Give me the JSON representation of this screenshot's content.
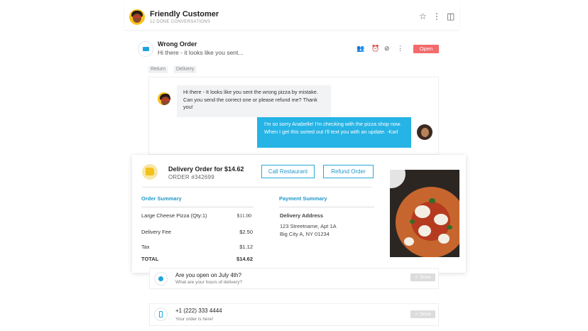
{
  "header": {
    "name": "Friendly Customer",
    "subtitle": "12 DONE CONVERSATIONS",
    "star_icon": "☆",
    "more_icon": "⋮",
    "panel_icon": "◫"
  },
  "conversation": {
    "title": "Wrong Order",
    "preview": "Hi there - it looks like you sent...",
    "assign_icon": "👥",
    "snooze_icon": "⏰",
    "done_icon": "⊘",
    "more_icon": "⋮",
    "status": "Open"
  },
  "tags": [
    "Return",
    "Delivery"
  ],
  "messages": {
    "incoming": "Hi there - It looks like you sent the wrong pizza by mistake. Can you send the correct one or please refund me? Thank you!",
    "outgoing": "I'm so sorry Anabelle! I'm checking with the pizza shop now. When I get this sorted out I'll text you with an update. -Karl"
  },
  "order": {
    "title": "Delivery Order for $14.62",
    "number": "ORDER #342699",
    "call_button": "Call Restaurant",
    "refund_button": "Refund Order",
    "summary_title": "Order Summary",
    "items": [
      {
        "label": "Large Cheese Pizza (Qty:1)",
        "value": "$11.00"
      },
      {
        "label": "Delivery Fee",
        "value": "$2.50"
      },
      {
        "label": "Tax",
        "value": "$1.12"
      }
    ],
    "total_label": "TOTAL",
    "total_value": "$14.62",
    "payment_title": "Payment Summary",
    "address_label": "Delivery Address",
    "address_line1": "123 Streetname, Apt 1A",
    "address_line2": "Big City A, NY 01234"
  },
  "items": [
    {
      "title": "Are you open on July 4th?",
      "subtitle": "What are your hours of delivery?",
      "done": "✓ Done"
    },
    {
      "title": "+1 (222) 333 4444",
      "subtitle": "Your order is here!",
      "done": "✓ Done"
    }
  ],
  "colors": {
    "accent": "#26b3e5",
    "open": "#f36b6b"
  }
}
